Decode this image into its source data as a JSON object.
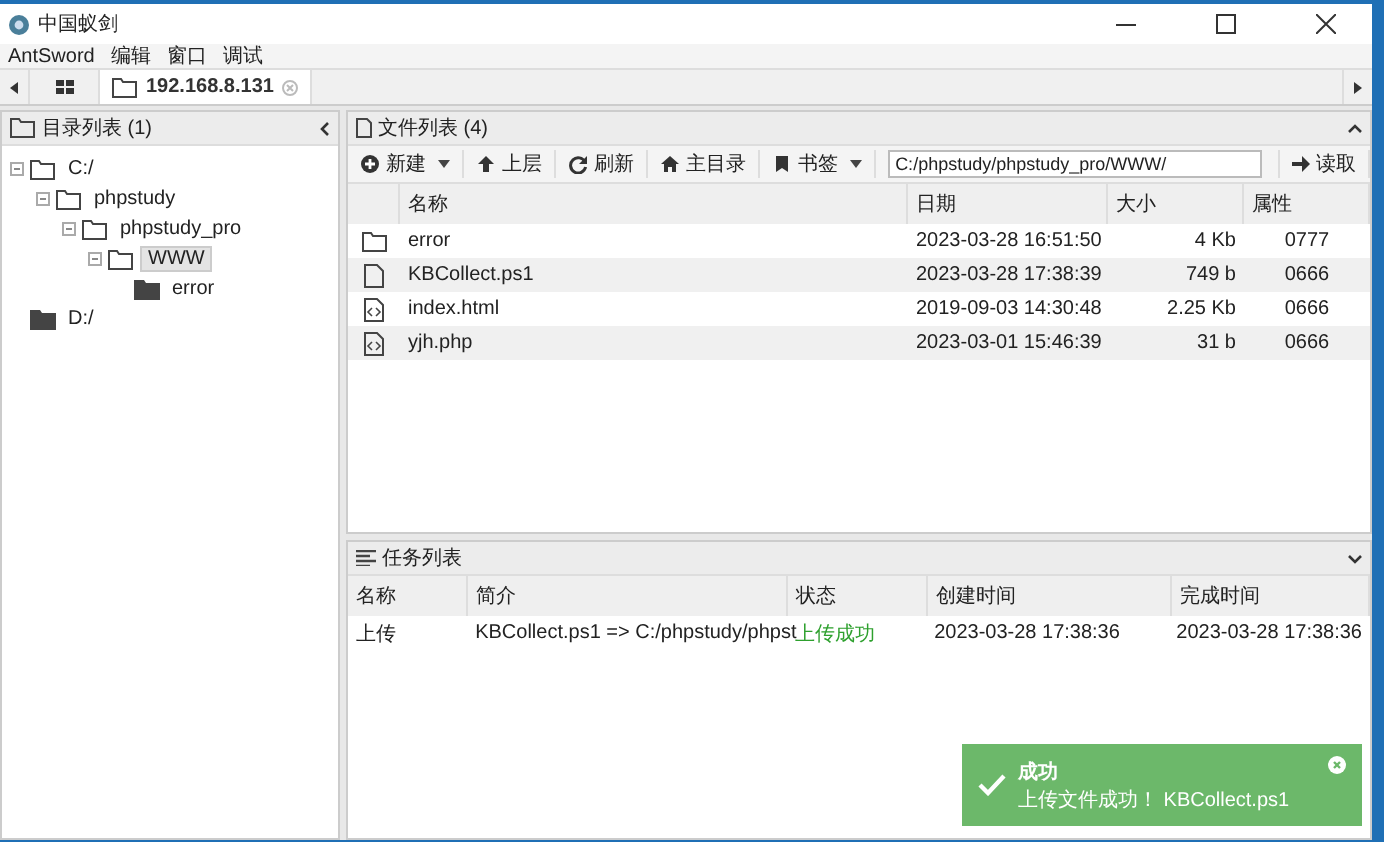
{
  "window": {
    "title": "中国蚁剑"
  },
  "menu": [
    "AntSword",
    "编辑",
    "窗口",
    "调试"
  ],
  "tabs": [
    {
      "label": "192.168.8.131",
      "selected": true
    }
  ],
  "dir_panel": {
    "title": "目录列表 (1)",
    "tree": [
      {
        "label": "C:/",
        "expanded": true,
        "selected": false,
        "children": [
          {
            "label": "phpstudy",
            "expanded": true,
            "selected": false,
            "children": [
              {
                "label": "phpstudy_pro",
                "expanded": true,
                "selected": false,
                "children": [
                  {
                    "label": "WWW",
                    "expanded": true,
                    "selected": true,
                    "children": [
                      {
                        "label": "error",
                        "expanded": false,
                        "selected": false
                      }
                    ]
                  }
                ]
              }
            ]
          }
        ]
      },
      {
        "label": "D:/",
        "expanded": false,
        "selected": false
      }
    ]
  },
  "file_panel": {
    "title": "文件列表 (4)",
    "toolbar": [
      {
        "label": "新建",
        "kind": "new",
        "dropdown": true
      },
      {
        "label": "上层",
        "kind": "up",
        "dropdown": false
      },
      {
        "label": "刷新",
        "kind": "refresh",
        "dropdown": false
      },
      {
        "label": "主目录",
        "kind": "home",
        "dropdown": false
      },
      {
        "label": "书签",
        "kind": "bookmark",
        "dropdown": true
      }
    ],
    "path": "C:/phpstudy/phpstudy_pro/WWW/",
    "read_button": "读取",
    "columns": [
      "名称",
      "日期",
      "大小",
      "属性"
    ],
    "rows": [
      {
        "kind": "folder",
        "name": "error",
        "date": "2023-03-28 16:51:50",
        "size": "4 Kb",
        "attr": "0777"
      },
      {
        "kind": "file",
        "name": "KBCollect.ps1",
        "date": "2023-03-28 17:38:39",
        "size": "749 b",
        "attr": "0666"
      },
      {
        "kind": "code",
        "name": "index.html",
        "date": "2019-09-03 14:30:48",
        "size": "2.25 Kb",
        "attr": "0666"
      },
      {
        "kind": "code",
        "name": "yjh.php",
        "date": "2023-03-01 15:46:39",
        "size": "31 b",
        "attr": "0666"
      }
    ]
  },
  "task_panel": {
    "title": "任务列表",
    "columns": [
      "名称",
      "简介",
      "状态",
      "创建时间",
      "完成时间"
    ],
    "rows": [
      {
        "name": "上传",
        "brief": "KBCollect.ps1 => C:/phpstudy/phpst",
        "status": "上传成功",
        "created": "2023-03-28 17:38:36",
        "finished": "2023-03-28 17:38:36"
      }
    ]
  },
  "toast": {
    "title": "成功",
    "message": "上传文件成功！ KBCollect.ps1"
  }
}
